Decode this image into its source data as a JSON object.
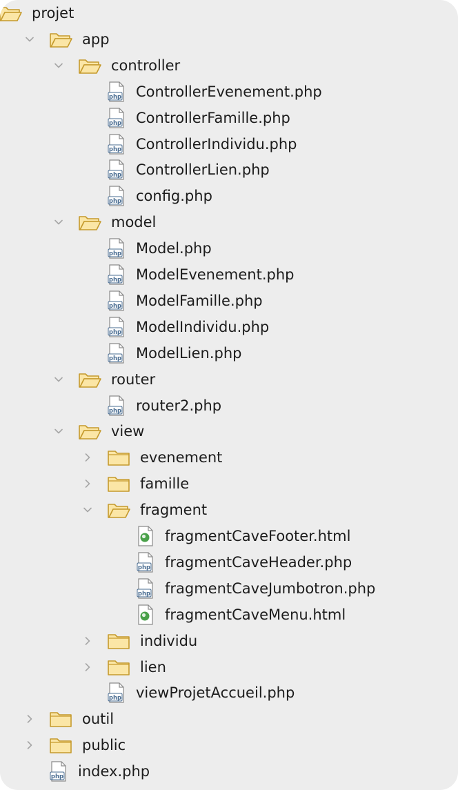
{
  "tree": {
    "items": [
      {
        "label": "projet",
        "kind": "folder-open",
        "depth": 0,
        "expander": "none"
      },
      {
        "label": "app",
        "kind": "folder-open",
        "depth": 1,
        "expander": "expanded"
      },
      {
        "label": "controller",
        "kind": "folder-open",
        "depth": 2,
        "expander": "expanded"
      },
      {
        "label": "ControllerEvenement.php",
        "kind": "php",
        "depth": 3,
        "expander": "none"
      },
      {
        "label": "ControllerFamille.php",
        "kind": "php",
        "depth": 3,
        "expander": "none"
      },
      {
        "label": "ControllerIndividu.php",
        "kind": "php",
        "depth": 3,
        "expander": "none"
      },
      {
        "label": "ControllerLien.php",
        "kind": "php",
        "depth": 3,
        "expander": "none"
      },
      {
        "label": "config.php",
        "kind": "php",
        "depth": 3,
        "expander": "none"
      },
      {
        "label": "model",
        "kind": "folder-open",
        "depth": 2,
        "expander": "expanded"
      },
      {
        "label": "Model.php",
        "kind": "php",
        "depth": 3,
        "expander": "none"
      },
      {
        "label": "ModelEvenement.php",
        "kind": "php",
        "depth": 3,
        "expander": "none"
      },
      {
        "label": "ModelFamille.php",
        "kind": "php",
        "depth": 3,
        "expander": "none"
      },
      {
        "label": "ModelIndividu.php",
        "kind": "php",
        "depth": 3,
        "expander": "none"
      },
      {
        "label": "ModelLien.php",
        "kind": "php",
        "depth": 3,
        "expander": "none"
      },
      {
        "label": "router",
        "kind": "folder-open",
        "depth": 2,
        "expander": "expanded"
      },
      {
        "label": "router2.php",
        "kind": "php",
        "depth": 3,
        "expander": "none"
      },
      {
        "label": "view",
        "kind": "folder-open",
        "depth": 2,
        "expander": "expanded"
      },
      {
        "label": "evenement",
        "kind": "folder",
        "depth": 3,
        "expander": "collapsed"
      },
      {
        "label": "famille",
        "kind": "folder",
        "depth": 3,
        "expander": "collapsed"
      },
      {
        "label": "fragment",
        "kind": "folder-open",
        "depth": 3,
        "expander": "expanded"
      },
      {
        "label": "fragmentCaveFooter.html",
        "kind": "html",
        "depth": 4,
        "expander": "none"
      },
      {
        "label": "fragmentCaveHeader.php",
        "kind": "php",
        "depth": 4,
        "expander": "none"
      },
      {
        "label": "fragmentCaveJumbotron.php",
        "kind": "php",
        "depth": 4,
        "expander": "none"
      },
      {
        "label": "fragmentCaveMenu.html",
        "kind": "html",
        "depth": 4,
        "expander": "none"
      },
      {
        "label": "individu",
        "kind": "folder",
        "depth": 3,
        "expander": "collapsed"
      },
      {
        "label": "lien",
        "kind": "folder",
        "depth": 3,
        "expander": "collapsed"
      },
      {
        "label": "viewProjetAccueil.php",
        "kind": "php",
        "depth": 3,
        "expander": "none"
      },
      {
        "label": "outil",
        "kind": "folder",
        "depth": 1,
        "expander": "collapsed"
      },
      {
        "label": "public",
        "kind": "folder",
        "depth": 1,
        "expander": "collapsed"
      },
      {
        "label": "index.php",
        "kind": "php",
        "depth": 1,
        "expander": "none"
      }
    ]
  },
  "colors": {
    "panel_bg": "#ededed",
    "folder_fill": "#fbe6a6",
    "folder_stroke": "#c59a2d",
    "chevron": "#a6a6a6",
    "php_icon": "#4a6d92",
    "html_icon": "#4aa14a"
  },
  "icons": {
    "folder-open": "open-folder-icon",
    "folder": "folder-icon",
    "php": "php-file-icon",
    "html": "html-file-icon",
    "expanded": "chevron-down-icon",
    "collapsed": "chevron-right-icon"
  }
}
